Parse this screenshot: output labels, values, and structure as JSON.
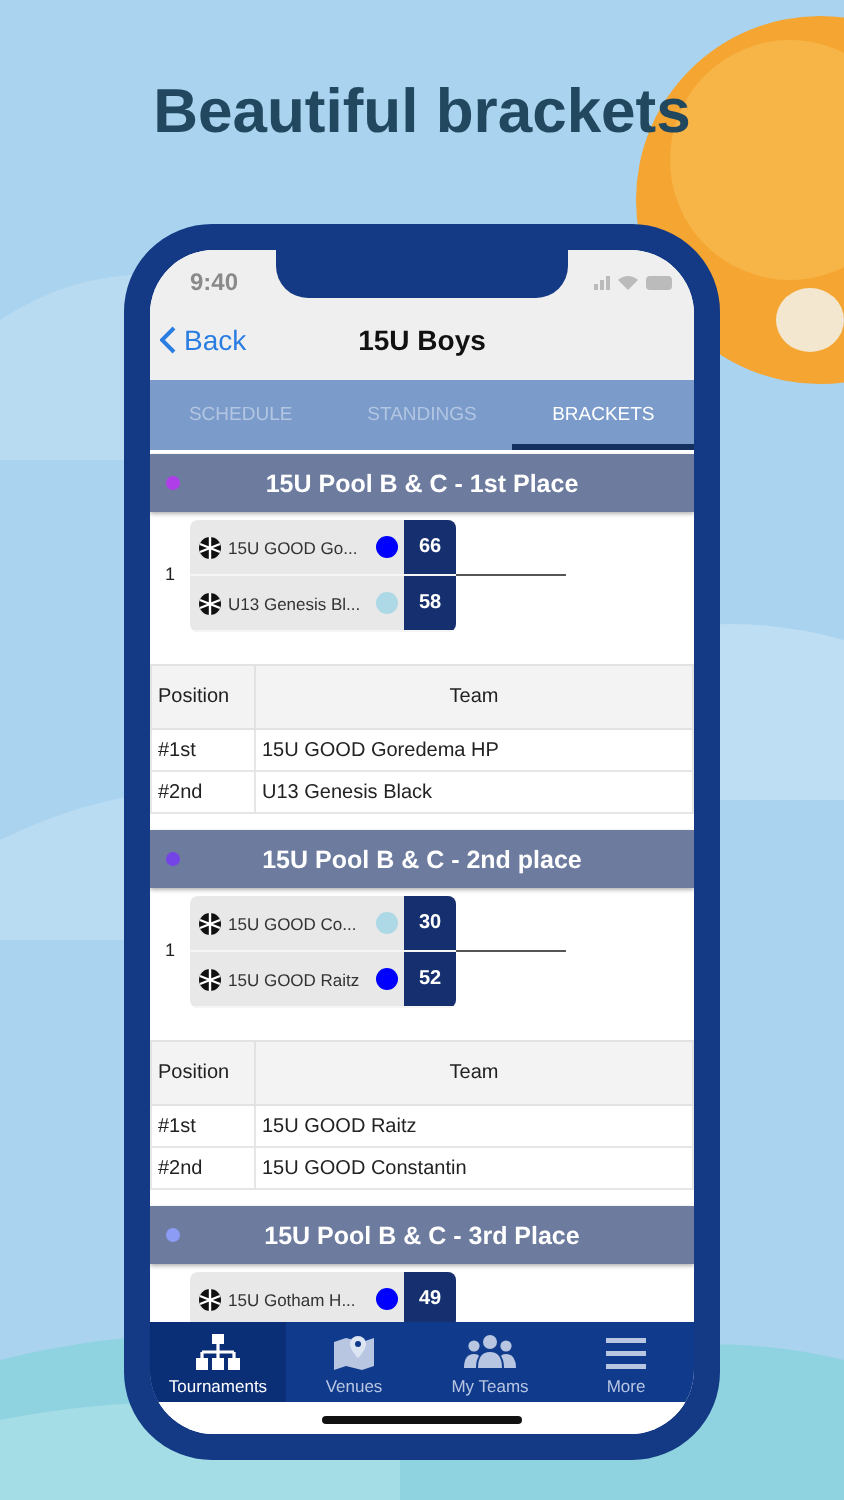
{
  "headline": "Beautiful brackets",
  "status_bar": {
    "time": "9:40"
  },
  "nav": {
    "back": "Back",
    "title": "15U Boys"
  },
  "tabs": [
    {
      "label": "SCHEDULE",
      "selected": false
    },
    {
      "label": "STANDINGS",
      "selected": false
    },
    {
      "label": "BRACKETS",
      "selected": true
    }
  ],
  "sections": [
    {
      "title": "15U Pool B & C - 1st Place",
      "color": "#b03ee8",
      "matches": [
        {
          "round": "1",
          "teams": [
            {
              "name": "15U GOOD Go...",
              "color": "#0000ff",
              "score": "66"
            },
            {
              "name": "U13 Genesis Bl...",
              "color": "#add8e6",
              "score": "58"
            }
          ]
        }
      ],
      "standings": {
        "columns": [
          "Position",
          "Team"
        ],
        "rows": [
          [
            "#1st",
            "15U GOOD Goredema HP"
          ],
          [
            "#2nd",
            "U13 Genesis Black"
          ]
        ]
      }
    },
    {
      "title": "15U Pool B & C - 2nd place",
      "color": "#7444e6",
      "matches": [
        {
          "round": "1",
          "teams": [
            {
              "name": "15U GOOD Co...",
              "color": "#add8e6",
              "score": "30"
            },
            {
              "name": "15U GOOD Raitz",
              "color": "#0000ff",
              "score": "52"
            }
          ]
        }
      ],
      "standings": {
        "columns": [
          "Position",
          "Team"
        ],
        "rows": [
          [
            "#1st",
            "15U GOOD Raitz"
          ],
          [
            "#2nd",
            "15U GOOD Constantin"
          ]
        ]
      }
    },
    {
      "title": "15U Pool B & C - 3rd Place",
      "color": "#8c9cf4",
      "matches": [
        {
          "teams": [
            {
              "name": "15U Gotham H...",
              "color": "#0000ff",
              "score": "49"
            }
          ]
        }
      ]
    }
  ],
  "tab_bar": [
    {
      "label": "Tournaments",
      "kind": "tree",
      "selected": true
    },
    {
      "label": "Venues",
      "kind": "map",
      "selected": false
    },
    {
      "label": "My Teams",
      "kind": "people",
      "selected": false
    },
    {
      "label": "More",
      "kind": "menu",
      "selected": false
    }
  ]
}
